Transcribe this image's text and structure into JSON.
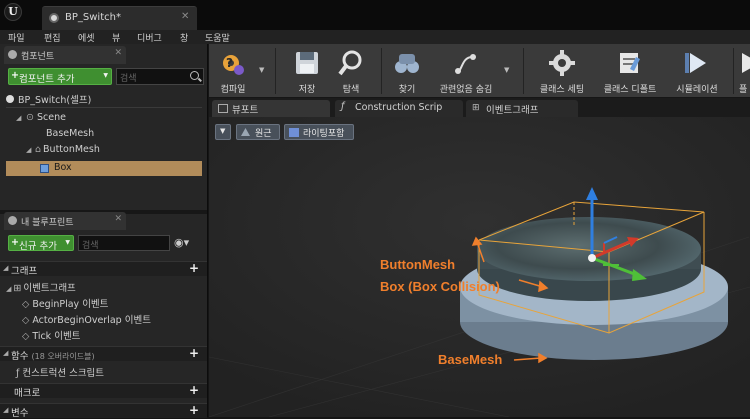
{
  "window": {
    "tab_title": "BP_Switch*",
    "logo_glyph": "U"
  },
  "menu": [
    "파일",
    "편집",
    "에셋",
    "뷰",
    "디버그",
    "창",
    "도움말"
  ],
  "components": {
    "tab_label": "컴포넌트",
    "add_button": "컴포넌트 추가",
    "search_placeholder": "검색",
    "self_item": "BP_Switch(셀프)",
    "tree": [
      "Scene",
      "BaseMesh",
      "ButtonMesh",
      "Box"
    ]
  },
  "blueprint": {
    "tab_label": "내 블루프린트",
    "add_button": "신규 추가",
    "search_placeholder": "검색",
    "sections": {
      "graph": "그래프",
      "event_graph": "이벤트그래프",
      "events": [
        "BeginPlay 이벤트",
        "ActorBeginOverlap 이벤트",
        "Tick 이벤트"
      ],
      "functions": "함수",
      "functions_note": "(18 오버라이드블)",
      "construction": "컨스트럭션 스크립트",
      "macros": "매크로",
      "variables": "변수"
    }
  },
  "toolbar": {
    "compile": "컴파일",
    "save": "저장",
    "browse": "탐색",
    "find": "찾기",
    "hide_unrelated": "관련없음 숨김",
    "class_settings": "클래스 세팅",
    "class_defaults": "클래스 디폴트",
    "simulation": "시뮬레이션",
    "play_partial": "플"
  },
  "editor_tabs": [
    "뷰포트",
    "Construction Scrip",
    "이벤트그래프"
  ],
  "viewport": {
    "perspective": "원근",
    "lighting": "라이팅포함",
    "annotations": {
      "button_mesh": "ButtonMesh",
      "box": "Box (Box Collision)",
      "base_mesh": "BaseMesh"
    }
  },
  "colors": {
    "accent_orange": "#f07f2c",
    "green_button": "#3f8f30",
    "selection": "#b28c5a"
  }
}
